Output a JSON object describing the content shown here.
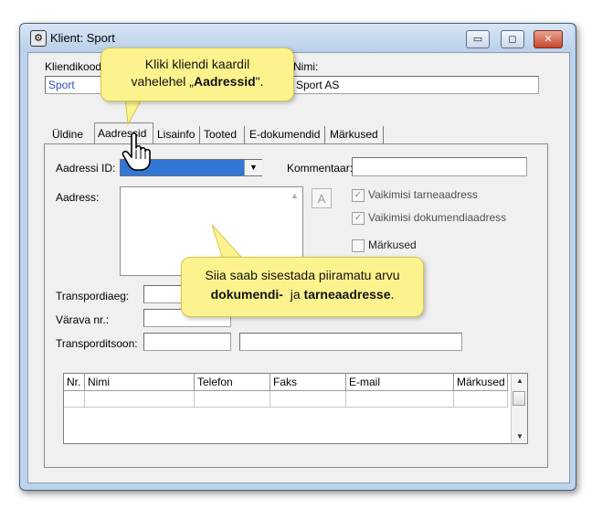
{
  "window": {
    "title": "Klient: Sport",
    "controls": {
      "minimize": "▭",
      "maximize": "◻",
      "close": "✕"
    }
  },
  "header": {
    "client_code_label": "Kliendikood",
    "client_code_value": "Sport",
    "name_label": "Nimi:",
    "name_value": "Sport AS"
  },
  "tabs": [
    {
      "label": "Üldine",
      "active": false
    },
    {
      "label": "Aadressid",
      "active": true
    },
    {
      "label": "Lisainfo",
      "active": false
    },
    {
      "label": "Tooted",
      "active": false
    },
    {
      "label": "E-dokumendid",
      "active": false
    },
    {
      "label": "Märkused",
      "active": false
    }
  ],
  "address_form": {
    "address_id_label": "Aadressi ID:",
    "comment_label": "Kommentaar:",
    "address_label": "Aadress:",
    "a_button_label": "A",
    "default_delivery_label": "Vaikimisi tarneaadress",
    "default_document_label": "Vaikimisi dokumendiaadress",
    "notes_label": "Märkused",
    "transport_days_label": "Transpordiaeg:",
    "gate_label": "Värava nr.:",
    "transport_zone_label": "Transporditsoon:"
  },
  "contacts_grid": {
    "columns": [
      "Nr.",
      "Nimi",
      "Telefon",
      "Faks",
      "E-mail",
      "Märkused"
    ]
  },
  "callouts": {
    "top_line1": "Kliki kliendi kaardil",
    "top_line2_pre": "vahelehel „",
    "top_line2_bold": "Aadressid",
    "top_line2_post": "\".",
    "bottom_line1": "Siia saab sisestada piiramatu arvu",
    "bottom_line2_bold1": "dokumendi-",
    "bottom_line2_mid": "  ja ",
    "bottom_line2_bold2": "tarneaadresse",
    "bottom_line2_post": "."
  },
  "colors": {
    "callout_bg": "#fdf38e",
    "selection_blue": "#3178d6",
    "window_frame": "#bcd3ec"
  },
  "icons": [
    "app-icon",
    "dropdown-arrow-icon",
    "hand-cursor-icon",
    "scroll-up-icon",
    "scroll-down-icon"
  ]
}
